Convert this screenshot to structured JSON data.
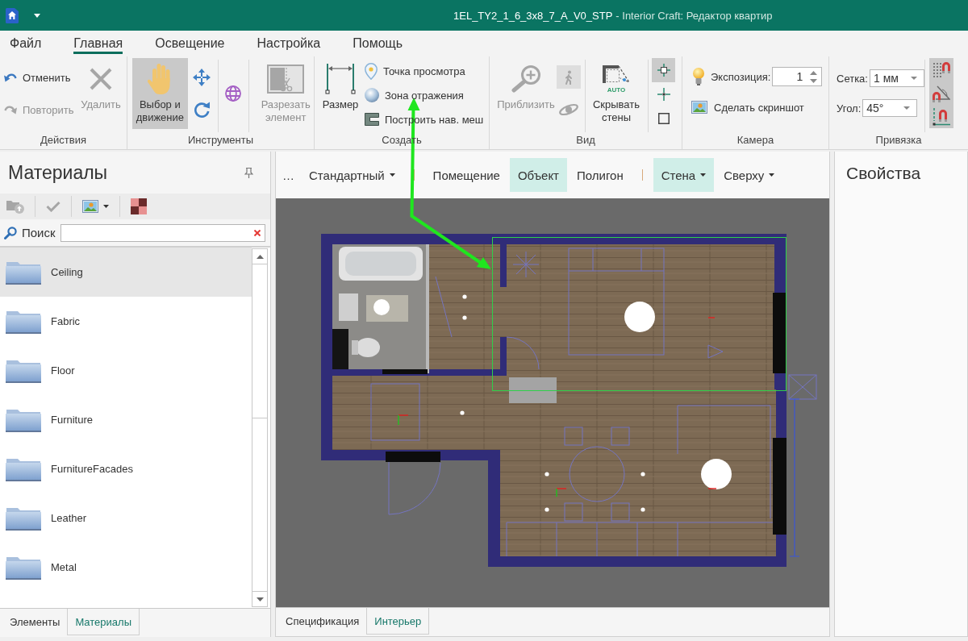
{
  "window": {
    "document": "1EL_TY2_1_6_3x8_7_A_V0_STP",
    "app": "- Interior Craft: Редактор квартир"
  },
  "menu_tabs": [
    {
      "label": "Файл",
      "selected": false
    },
    {
      "label": "Главная",
      "selected": true
    },
    {
      "label": "Освещение",
      "selected": false
    },
    {
      "label": "Настройка",
      "selected": false
    },
    {
      "label": "Помощь",
      "selected": false
    }
  ],
  "ribbon": {
    "actions": {
      "title": "Действия",
      "undo": {
        "label": "Отменить",
        "disabled": false
      },
      "redo": {
        "label": "Повторить",
        "disabled": true
      },
      "delete": {
        "label": "Удалить",
        "disabled": true
      }
    },
    "tools": {
      "title": "Инструменты",
      "select_move": {
        "label": "Выбор и движение",
        "selected": true
      },
      "cut_element": {
        "label": "Разрезать элемент",
        "disabled": true
      }
    },
    "create": {
      "title": "Создать",
      "dimension": {
        "label": "Размер"
      },
      "viewpoint": {
        "label": "Точка просмотра"
      },
      "reflection_zone": {
        "label": "Зона отражения"
      },
      "nav_mesh": {
        "label": "Построить нав. меш"
      }
    },
    "view": {
      "title": "Вид",
      "zoom_in": {
        "label": "Приблизить",
        "disabled": true
      },
      "walk": {
        "selected": true,
        "disabled": true
      },
      "orbit": {
        "disabled": true
      },
      "hide_walls": {
        "label": "Скрывать стены",
        "badge": "AUTO"
      },
      "snap_modes": [
        {
          "kind": "node",
          "selected": true
        },
        {
          "kind": "center",
          "selected": false
        },
        {
          "kind": "square",
          "selected": false
        }
      ]
    },
    "camera": {
      "title": "Камера",
      "exposure": {
        "label": "Экспозиция:",
        "value": "1"
      },
      "screenshot": {
        "label": "Сделать скриншот"
      }
    },
    "snapping": {
      "title": "Привязка",
      "grid": {
        "label": "Сетка:",
        "value": "1 мм"
      },
      "angle": {
        "label": "Угол:",
        "value": "45°"
      },
      "magnets": [
        {
          "kind": "grid",
          "on": true
        },
        {
          "kind": "angle",
          "on": true
        },
        {
          "kind": "line",
          "on": true
        }
      ]
    }
  },
  "materials_panel": {
    "title": "Материалы",
    "toolbar": {
      "import": {
        "disabled": true
      },
      "apply": {
        "disabled": true
      }
    },
    "search": {
      "label": "Поиск"
    },
    "items": [
      {
        "name": "Ceiling",
        "selected": true
      },
      {
        "name": "Fabric",
        "selected": false
      },
      {
        "name": "Floor",
        "selected": false
      },
      {
        "name": "Furniture",
        "selected": false
      },
      {
        "name": "FurnitureFacades",
        "selected": false
      },
      {
        "name": "Leather",
        "selected": false
      },
      {
        "name": "Metal",
        "selected": false
      }
    ],
    "tabs": [
      {
        "label": "Элементы",
        "selected": false
      },
      {
        "label": "Материалы",
        "selected": true
      }
    ]
  },
  "view_panel": {
    "toolbar": {
      "more": "…",
      "items": [
        {
          "kind": "dropdown",
          "label": "Стандартный",
          "selected": false
        },
        {
          "kind": "separator"
        },
        {
          "kind": "button",
          "label": "Помещение",
          "selected": false
        },
        {
          "kind": "button",
          "label": "Объект",
          "selected": true
        },
        {
          "kind": "button",
          "label": "Полигон",
          "selected": false
        },
        {
          "kind": "separator"
        },
        {
          "kind": "dropdown",
          "label": "Стена",
          "selected": true
        },
        {
          "kind": "dropdown",
          "label": "Сверху",
          "selected": false
        }
      ]
    },
    "tabs": [
      {
        "label": "Спецификация",
        "selected": false
      },
      {
        "label": "Интерьер",
        "selected": true
      }
    ]
  },
  "properties_panel": {
    "title": "Свойства"
  }
}
